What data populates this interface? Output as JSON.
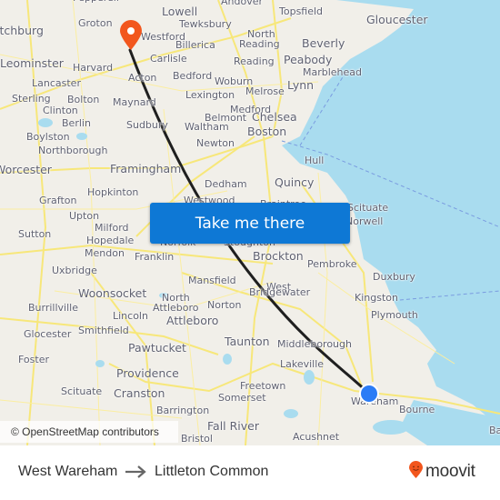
{
  "map": {
    "attribution": "© OpenStreetMap contributors",
    "cta_label": "Take me there",
    "colors": {
      "land": "#f1efe9",
      "water": "#a9dcef",
      "roads": "#f7e77a",
      "route": "#1f1f1f",
      "cta": "#0e78d5",
      "destination_pin": "#f2561d",
      "origin_dot": "#2b7cf6"
    },
    "places": [
      {
        "name": "Groton",
        "size": "sm"
      },
      {
        "name": "Lowell",
        "size": "md"
      },
      {
        "name": "Tewksbury",
        "size": "sm"
      },
      {
        "name": "Andover",
        "size": "sm"
      },
      {
        "name": "Topsfield",
        "size": "sm"
      },
      {
        "name": "Gloucester",
        "size": "md"
      },
      {
        "name": "Pepperell",
        "size": "sm"
      },
      {
        "name": "itchburg",
        "size": "md"
      },
      {
        "name": "Westford",
        "size": "sm"
      },
      {
        "name": "Billerica",
        "size": "sm"
      },
      {
        "name": "North",
        "size": "sm"
      },
      {
        "name": "Reading",
        "size": "sm"
      },
      {
        "name": "Beverly",
        "size": "md"
      },
      {
        "name": "Leominster",
        "size": "md"
      },
      {
        "name": "Harvard",
        "size": "sm"
      },
      {
        "name": "Carlisle",
        "size": "sm"
      },
      {
        "name": "Reading",
        "size": "sm"
      },
      {
        "name": "Peabody",
        "size": "md"
      },
      {
        "name": "Marblehead",
        "size": "sm"
      },
      {
        "name": "Lancaster",
        "size": "sm"
      },
      {
        "name": "Acton",
        "size": "sm"
      },
      {
        "name": "Bedford",
        "size": "sm"
      },
      {
        "name": "Woburn",
        "size": "sm"
      },
      {
        "name": "Melrose",
        "size": "sm"
      },
      {
        "name": "Lynn",
        "size": "md"
      },
      {
        "name": "Sterling",
        "size": "sm"
      },
      {
        "name": "Bolton",
        "size": "sm"
      },
      {
        "name": "Maynard",
        "size": "sm"
      },
      {
        "name": "Lexington",
        "size": "sm"
      },
      {
        "name": "Clinton",
        "size": "sm"
      },
      {
        "name": "Medford",
        "size": "sm"
      },
      {
        "name": "Belmont",
        "size": "sm"
      },
      {
        "name": "Chelsea",
        "size": "md"
      },
      {
        "name": "Berlin",
        "size": "sm"
      },
      {
        "name": "Sudbury",
        "size": "sm"
      },
      {
        "name": "Waltham",
        "size": "sm"
      },
      {
        "name": "Boston",
        "size": "md"
      },
      {
        "name": "Boylston",
        "size": "sm"
      },
      {
        "name": "Newton",
        "size": "sm"
      },
      {
        "name": "Northborough",
        "size": "sm"
      },
      {
        "name": "Hull",
        "size": "sm"
      },
      {
        "name": "Worcester",
        "size": "md"
      },
      {
        "name": "Framingham",
        "size": "md"
      },
      {
        "name": "Dedham",
        "size": "sm"
      },
      {
        "name": "Quincy",
        "size": "md"
      },
      {
        "name": "Grafton",
        "size": "sm"
      },
      {
        "name": "Hopkinton",
        "size": "sm"
      },
      {
        "name": "Westwood",
        "size": "sm"
      },
      {
        "name": "Braintree",
        "size": "sm"
      },
      {
        "name": "Scituate",
        "size": "sm"
      },
      {
        "name": "Upton",
        "size": "sm"
      },
      {
        "name": "Milford",
        "size": "sm"
      },
      {
        "name": "Norwell",
        "size": "sm"
      },
      {
        "name": "Sutton",
        "size": "sm"
      },
      {
        "name": "Hopedale",
        "size": "sm"
      },
      {
        "name": "Norfolk",
        "size": "sm"
      },
      {
        "name": "Stoughton",
        "size": "sm"
      },
      {
        "name": "Mendon",
        "size": "sm"
      },
      {
        "name": "Franklin",
        "size": "sm"
      },
      {
        "name": "Brockton",
        "size": "md"
      },
      {
        "name": "Pembroke",
        "size": "sm"
      },
      {
        "name": "Uxbridge",
        "size": "sm"
      },
      {
        "name": "Mansfield",
        "size": "sm"
      },
      {
        "name": "West",
        "size": "sm"
      },
      {
        "name": "Bridgewater",
        "size": "sm"
      },
      {
        "name": "Duxbury",
        "size": "sm"
      },
      {
        "name": "Woonsocket",
        "size": "md"
      },
      {
        "name": "Kingston",
        "size": "sm"
      },
      {
        "name": "Burrillville",
        "size": "sm"
      },
      {
        "name": "North",
        "size": "sm"
      },
      {
        "name": "Attleboro",
        "size": "sm"
      },
      {
        "name": "Norton",
        "size": "sm"
      },
      {
        "name": "Plymouth",
        "size": "sm"
      },
      {
        "name": "Lincoln",
        "size": "sm"
      },
      {
        "name": "Attleboro",
        "size": "md"
      },
      {
        "name": "Glocester",
        "size": "sm"
      },
      {
        "name": "Smithfield",
        "size": "sm"
      },
      {
        "name": "Taunton",
        "size": "md"
      },
      {
        "name": "Middleborough",
        "size": "sm"
      },
      {
        "name": "Pawtucket",
        "size": "md"
      },
      {
        "name": "Foster",
        "size": "sm"
      },
      {
        "name": "Lakeville",
        "size": "sm"
      },
      {
        "name": "Providence",
        "size": "md"
      },
      {
        "name": "Freetown",
        "size": "sm"
      },
      {
        "name": "Scituate",
        "size": "sm"
      },
      {
        "name": "Cranston",
        "size": "md"
      },
      {
        "name": "Somerset",
        "size": "sm"
      },
      {
        "name": "Wareham",
        "size": "sm"
      },
      {
        "name": "Bourne",
        "size": "sm"
      },
      {
        "name": "Barrington",
        "size": "sm"
      },
      {
        "name": "Fall River",
        "size": "md"
      },
      {
        "name": "Bristol",
        "size": "sm"
      },
      {
        "name": "Acushnet",
        "size": "sm"
      },
      {
        "name": "Ba",
        "size": "sm"
      }
    ]
  },
  "footer": {
    "from": "West Wareham",
    "to": "Littleton Common",
    "brand": "moovit"
  }
}
